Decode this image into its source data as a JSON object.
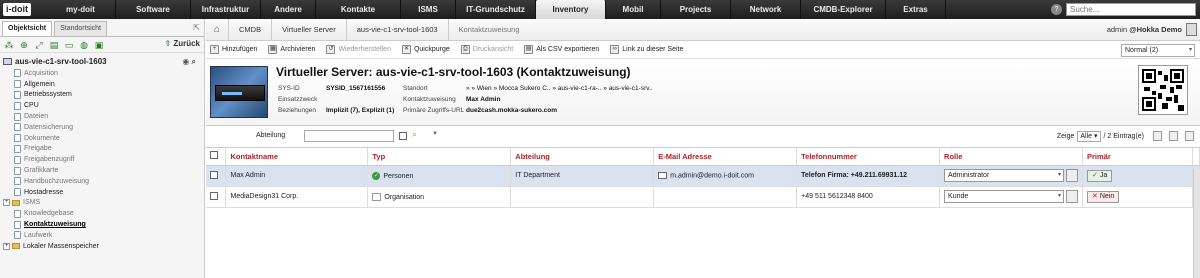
{
  "app": {
    "logo_text": "i-doit"
  },
  "topnav": {
    "items": [
      "my-doit",
      "Software",
      "Infrastruktur",
      "Andere",
      "Kontakte",
      "ISMS",
      "IT-Grundschutz",
      "Inventory",
      "Mobil",
      "Projects",
      "Network",
      "CMDB-Explorer",
      "Extras"
    ],
    "active_index": 7,
    "search_placeholder": "Suche..."
  },
  "left": {
    "tabs": [
      "Objektsicht",
      "Standortsicht"
    ],
    "back_label": "Zurück",
    "root": "aus-vie-c1-srv-tool-1603",
    "items": [
      {
        "label": "Acquisition",
        "state": "empty"
      },
      {
        "label": "Allgemein",
        "state": "on"
      },
      {
        "label": "Betriebssystem",
        "state": "on"
      },
      {
        "label": "CPU",
        "state": "on"
      },
      {
        "label": "Dateien",
        "state": "empty"
      },
      {
        "label": "Datensicherung",
        "state": "empty"
      },
      {
        "label": "Dokumente",
        "state": "empty"
      },
      {
        "label": "Freigabe",
        "state": "empty"
      },
      {
        "label": "Freigabenzugriff",
        "state": "empty"
      },
      {
        "label": "Grafikkarte",
        "state": "empty"
      },
      {
        "label": "Handbuchzuweisung",
        "state": "empty"
      },
      {
        "label": "Hostadresse",
        "state": "on"
      },
      {
        "label": "ISMS",
        "state": "folder"
      },
      {
        "label": "Knowledgebase",
        "state": "empty"
      },
      {
        "label": "Kontaktzuweisung",
        "state": "selected"
      },
      {
        "label": "Laufwerk",
        "state": "empty"
      },
      {
        "label": "Lokaler Massenspeicher",
        "state": "folder-on"
      }
    ]
  },
  "breadcrumb": [
    "CMDB",
    "Virtueller Server",
    "aus-vie-c1-srv-tool-1603",
    "Kontaktzuweisung"
  ],
  "user": {
    "name": "admin",
    "tenant": "@Hokka Demo"
  },
  "toolbar": {
    "buttons": [
      {
        "label": "Hinzufügen",
        "disabled": false
      },
      {
        "label": "Archivieren",
        "disabled": false
      },
      {
        "label": "Wiederherstellen",
        "disabled": true
      },
      {
        "label": "Quickpurge",
        "disabled": false
      },
      {
        "label": "Druckansicht",
        "disabled": true
      },
      {
        "label": "Als CSV exportieren",
        "disabled": false
      },
      {
        "label": "Link zu dieser Seite",
        "disabled": false
      }
    ],
    "view_select": "Normal (2)"
  },
  "object": {
    "title": "Virtueller Server: aus-vie-c1-srv-tool-1603 (Kontaktzuweisung)",
    "sysid_label": "SYS-ID",
    "sysid": "SYSID_1567161556",
    "einsatz_label": "Einsatzzweck",
    "einsatz": "",
    "bez_label": "Beziehungen",
    "bez": "Implizit (7), Explizit (1)",
    "standort_label": "Standort",
    "standort": "» » Wien » Mocca Sukero C.. » aus-vie-c1-ra-.. » aus-vie-c1-srv..",
    "kontakt_label": "Kontaktzuweisung",
    "kontakt": "Max Admin",
    "url_label": "Primäre Zugriffs-URL",
    "url": "due2cash.mokka-sukero.com"
  },
  "list": {
    "filter_label": "Abteilung",
    "zeige_label": "Zeige",
    "zeige_value": "Alle",
    "count_text": "/ 2 Eintrag(e)",
    "columns": [
      "Kontaktname",
      "Typ",
      "Abteilung",
      "E-Mail Adresse",
      "Telefonnummer",
      "Rolle",
      "Primär"
    ],
    "rows": [
      {
        "name": "Max Admin",
        "type": "Personen",
        "dept": "IT Department",
        "email": "m.admin@demo.i-doit.com",
        "phone": "Telefon Firma: +49.211.69931.12",
        "role": "Administrator",
        "primary": "Ja",
        "primary_yes": true
      },
      {
        "name": "MediaDesign31 Corp.",
        "type": "Organisation",
        "dept": "",
        "email": "",
        "phone": "+49 511 5612348 8400",
        "role": "Kunde",
        "primary": "Nein",
        "primary_yes": false
      }
    ]
  },
  "colors": {
    "topbar": "#2a2a2a",
    "header_text": "#b3202a",
    "selected_row": "#dbe2ef"
  }
}
